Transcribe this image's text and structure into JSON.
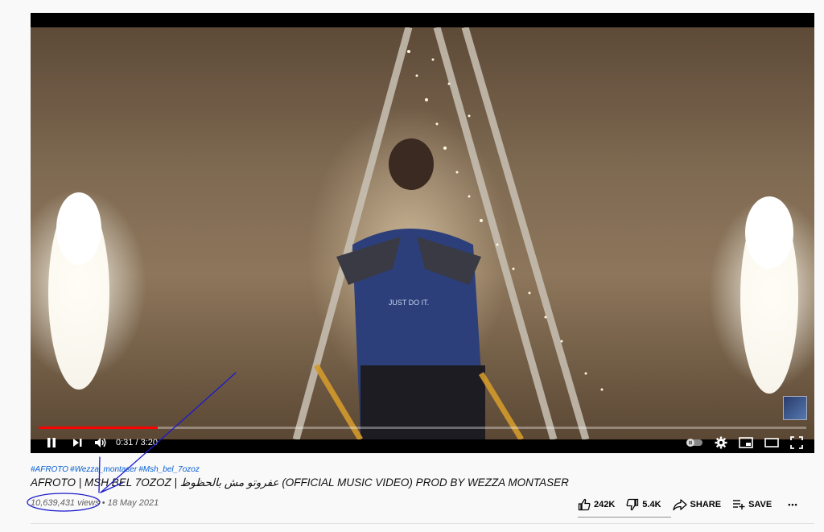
{
  "player": {
    "progress_fraction": 0.155,
    "time_current": "0:31",
    "time_separator": " / ",
    "time_total": "3:20",
    "shirt_text": "JUST DO IT."
  },
  "video": {
    "hashtags": [
      "#AFROTO",
      "#Wezza_montaser",
      "#Msh_bel_7ozoz"
    ],
    "title": "AFROTO | MSH BEL 7OZOZ | عفروتو مش بالحظوظ (OFFICIAL MUSIC VIDEO) PROD BY WEZZA MONTASER",
    "views": "10,639,431 views",
    "separator": " • ",
    "date": "18 May 2021"
  },
  "actions": {
    "like_count": "242K",
    "dislike_count": "5.4K",
    "share_label": "SHARE",
    "save_label": "SAVE",
    "more_label": "•••"
  },
  "colors": {
    "progress": "#ff0000",
    "hashtag": "#065fd4",
    "annotation": "#1a1acc"
  }
}
